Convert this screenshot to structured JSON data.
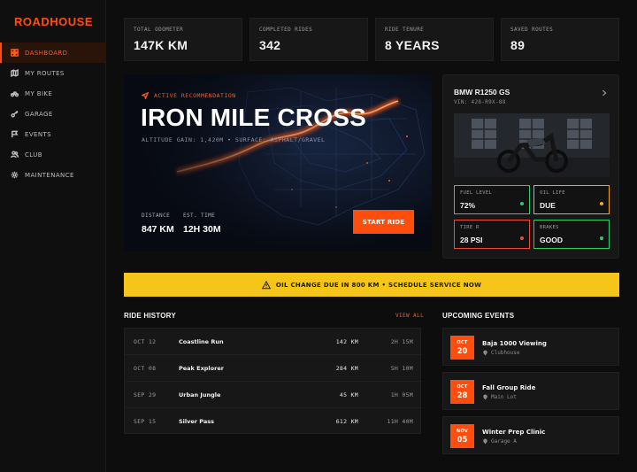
{
  "brand": {
    "logo": "ROADHOUSE",
    "accent": "#ff4d0d"
  },
  "sidebar": {
    "items": [
      {
        "label": "DASHBOARD",
        "icon": "dashboard-icon",
        "active": true
      },
      {
        "label": "MY ROUTES",
        "icon": "map-icon",
        "active": false
      },
      {
        "label": "MY BIKE",
        "icon": "motorcycle-icon",
        "active": false
      },
      {
        "label": "GARAGE",
        "icon": "wrench-icon",
        "active": false
      },
      {
        "label": "EVENTS",
        "icon": "flag-icon",
        "active": false
      },
      {
        "label": "CLUB",
        "icon": "users-icon",
        "active": false
      },
      {
        "label": "MAINTENANCE",
        "icon": "gear-icon",
        "active": false
      }
    ]
  },
  "stats": [
    {
      "label": "TOTAL ODOMETER",
      "value": "147K KM"
    },
    {
      "label": "COMPLETED RIDES",
      "value": "342"
    },
    {
      "label": "RIDE TENURE",
      "value": "8 YEARS"
    },
    {
      "label": "SAVED ROUTES",
      "value": "89"
    }
  ],
  "hero": {
    "tag": "ACTIVE RECOMMENDATION",
    "title": "IRON MILE CROSS",
    "subtitle": "ALTITUDE GAIN: 1,420M • SURFACE: ASPHALT/GRAVEL",
    "distance_label": "DISTANCE",
    "distance_value": "847 KM",
    "time_label": "EST. TIME",
    "time_value": "12H 30M",
    "button": "START RIDE"
  },
  "bike": {
    "name": "BMW R1250 GS",
    "vin": "VIN: 428-R9X-88",
    "gauges": [
      {
        "label": "FUEL LEVEL",
        "value": "72%",
        "color": "#2ecc71"
      },
      {
        "label": "OIL LIFE",
        "value": "DUE",
        "color": "#f5a623"
      },
      {
        "label": "TIRE R",
        "value": "28 PSI",
        "color": "#e74c3c"
      },
      {
        "label": "BRAKES",
        "value": "GOOD",
        "color": "#2ecc71"
      }
    ]
  },
  "alert": {
    "text": "OIL CHANGE DUE IN 800 KM • SCHEDULE SERVICE NOW",
    "color": "#f5c518"
  },
  "history": {
    "title": "RIDE HISTORY",
    "view_all": "VIEW ALL",
    "rows": [
      {
        "date": "OCT 12",
        "name": "Coastline Run",
        "distance": "142 KM",
        "time": "2H 15M"
      },
      {
        "date": "OCT 08",
        "name": "Peak Explorer",
        "distance": "284 KM",
        "time": "5H 10M"
      },
      {
        "date": "SEP 29",
        "name": "Urban Jungle",
        "distance": "45 KM",
        "time": "1H 05M"
      },
      {
        "date": "SEP 15",
        "name": "Silver Pass",
        "distance": "612 KM",
        "time": "11H 40M"
      }
    ]
  },
  "events": {
    "title": "UPCOMING EVENTS",
    "items": [
      {
        "month": "OCT",
        "day": "20",
        "title": "Baja 1000 Viewing",
        "location": "Clubhouse"
      },
      {
        "month": "OCT",
        "day": "28",
        "title": "Fall Group Ride",
        "location": "Main Lot"
      },
      {
        "month": "NOV",
        "day": "05",
        "title": "Winter Prep Clinic",
        "location": "Garage A"
      }
    ]
  }
}
